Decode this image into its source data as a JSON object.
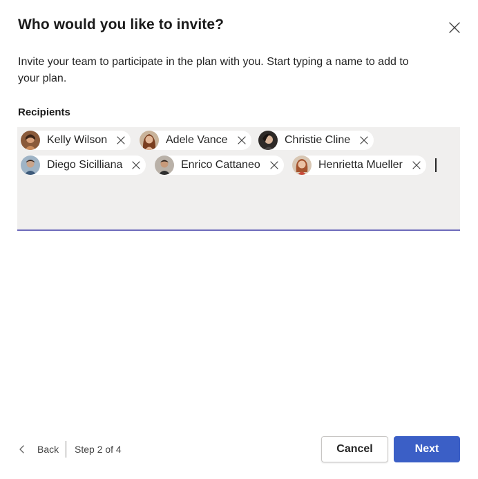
{
  "dialog": {
    "title": "Who would you like to invite?",
    "description": "Invite your team to participate in the plan with you. Start typing a name to add to your plan.",
    "close_icon": "close-icon"
  },
  "recipients": {
    "label": "Recipients",
    "people": [
      {
        "name": "Kelly Wilson"
      },
      {
        "name": "Adele Vance"
      },
      {
        "name": "Christie Cline"
      },
      {
        "name": "Diego Sicilliana"
      },
      {
        "name": "Enrico Cattaneo"
      },
      {
        "name": "Henrietta Mueller"
      }
    ]
  },
  "footer": {
    "back_label": "Back",
    "step_text": "Step 2 of 4",
    "cancel_label": "Cancel",
    "next_label": "Next"
  },
  "colors": {
    "accent": "#3b5fc6",
    "picker_background": "#f0efee",
    "picker_underline": "#6c6abb"
  }
}
